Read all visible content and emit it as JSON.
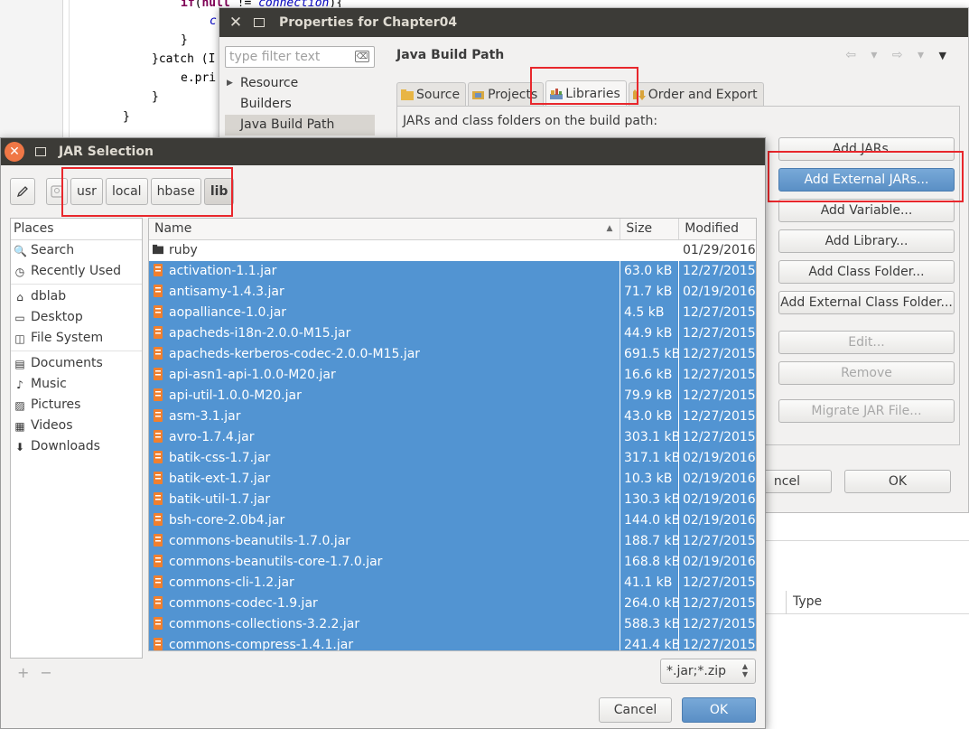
{
  "code": {
    "lines": [
      {
        "kw1": "if",
        "p1": "(",
        "kw2": "null",
        "p2": " != ",
        "it": "connection",
        "p3": "){"
      },
      {
        "text": "c"
      },
      {
        "text": "}"
      },
      {
        "text": "}catch (I"
      },
      {
        "text": "e.pri"
      },
      {
        "text": "}"
      },
      {
        "text": "}"
      }
    ]
  },
  "properties": {
    "title": "Properties for Chapter04",
    "filter_placeholder": "type filter text",
    "filter_clear": "⌫",
    "tree": [
      {
        "label": "Resource",
        "expand": "▶"
      },
      {
        "label": "Builders"
      },
      {
        "label": "Java Build Path"
      }
    ],
    "header": "Java Build Path",
    "nav_arrows": "⇦ ▾ ⇨ ▾",
    "nav_menu": "▼",
    "tabs": [
      "Source",
      "Projects",
      "Libraries",
      "Order and Export"
    ],
    "panel_label": "JARs and class folders on the build path:",
    "buttons": {
      "add_jars": "Add JARs...",
      "add_external_jars": "Add External JARs...",
      "add_variable": "Add Variable...",
      "add_library": "Add Library...",
      "add_class_folder": "Add Class Folder...",
      "add_external_class_folder": "Add External Class Folder...",
      "edit": "Edit...",
      "remove": "Remove",
      "migrate": "Migrate JAR File...",
      "cancel": "ncel",
      "ok": "OK"
    }
  },
  "bottom": {
    "type_col": "Type"
  },
  "jar": {
    "title": "JAR Selection",
    "close": "✕",
    "path": [
      "usr",
      "local",
      "hbase",
      "lib"
    ],
    "places_header": "Places",
    "places": [
      {
        "label": "Search",
        "icon": "🔍"
      },
      {
        "label": "Recently Used",
        "icon": "◷"
      },
      {
        "sep": true
      },
      {
        "label": "dblab",
        "icon": "⌂"
      },
      {
        "label": "Desktop",
        "icon": "▭"
      },
      {
        "label": "File System",
        "icon": "◫"
      },
      {
        "sep": true
      },
      {
        "label": "Documents",
        "icon": "▤"
      },
      {
        "label": "Music",
        "icon": "♪"
      },
      {
        "label": "Pictures",
        "icon": "▨"
      },
      {
        "label": "Videos",
        "icon": "▦"
      },
      {
        "label": "Downloads",
        "icon": "⬇"
      }
    ],
    "places_add": "+",
    "places_remove": "−",
    "columns": {
      "name": "Name",
      "size": "Size",
      "modified": "Modified"
    },
    "files": [
      {
        "name": "ruby",
        "size": "",
        "modified": "01/29/2016",
        "folder": true,
        "selected": false
      },
      {
        "name": "activation-1.1.jar",
        "size": "63.0 kB",
        "modified": "12/27/2015",
        "selected": true
      },
      {
        "name": "antisamy-1.4.3.jar",
        "size": "71.7 kB",
        "modified": "02/19/2016",
        "selected": true
      },
      {
        "name": "aopalliance-1.0.jar",
        "size": "4.5 kB",
        "modified": "12/27/2015",
        "selected": true
      },
      {
        "name": "apacheds-i18n-2.0.0-M15.jar",
        "size": "44.9 kB",
        "modified": "12/27/2015",
        "selected": true
      },
      {
        "name": "apacheds-kerberos-codec-2.0.0-M15.jar",
        "size": "691.5 kB",
        "modified": "12/27/2015",
        "selected": true
      },
      {
        "name": "api-asn1-api-1.0.0-M20.jar",
        "size": "16.6 kB",
        "modified": "12/27/2015",
        "selected": true
      },
      {
        "name": "api-util-1.0.0-M20.jar",
        "size": "79.9 kB",
        "modified": "12/27/2015",
        "selected": true
      },
      {
        "name": "asm-3.1.jar",
        "size": "43.0 kB",
        "modified": "12/27/2015",
        "selected": true
      },
      {
        "name": "avro-1.7.4.jar",
        "size": "303.1 kB",
        "modified": "12/27/2015",
        "selected": true
      },
      {
        "name": "batik-css-1.7.jar",
        "size": "317.1 kB",
        "modified": "02/19/2016",
        "selected": true
      },
      {
        "name": "batik-ext-1.7.jar",
        "size": "10.3 kB",
        "modified": "02/19/2016",
        "selected": true
      },
      {
        "name": "batik-util-1.7.jar",
        "size": "130.3 kB",
        "modified": "02/19/2016",
        "selected": true
      },
      {
        "name": "bsh-core-2.0b4.jar",
        "size": "144.0 kB",
        "modified": "02/19/2016",
        "selected": true
      },
      {
        "name": "commons-beanutils-1.7.0.jar",
        "size": "188.7 kB",
        "modified": "12/27/2015",
        "selected": true
      },
      {
        "name": "commons-beanutils-core-1.7.0.jar",
        "size": "168.8 kB",
        "modified": "02/19/2016",
        "selected": true
      },
      {
        "name": "commons-cli-1.2.jar",
        "size": "41.1 kB",
        "modified": "12/27/2015",
        "selected": true
      },
      {
        "name": "commons-codec-1.9.jar",
        "size": "264.0 kB",
        "modified": "12/27/2015",
        "selected": true
      },
      {
        "name": "commons-collections-3.2.2.jar",
        "size": "588.3 kB",
        "modified": "12/27/2015",
        "selected": true
      },
      {
        "name": "commons-compress-1.4.1.jar",
        "size": "241.4 kB",
        "modified": "12/27/2015",
        "selected": true
      }
    ],
    "filter_value": "*.jar;*.zip",
    "cancel": "Cancel",
    "ok": "OK"
  },
  "colors": {
    "selection": "#5294d2",
    "titlebar": "#3c3b37",
    "highlight_box": "#e8272c",
    "primary_button": "#5a8fc5"
  }
}
